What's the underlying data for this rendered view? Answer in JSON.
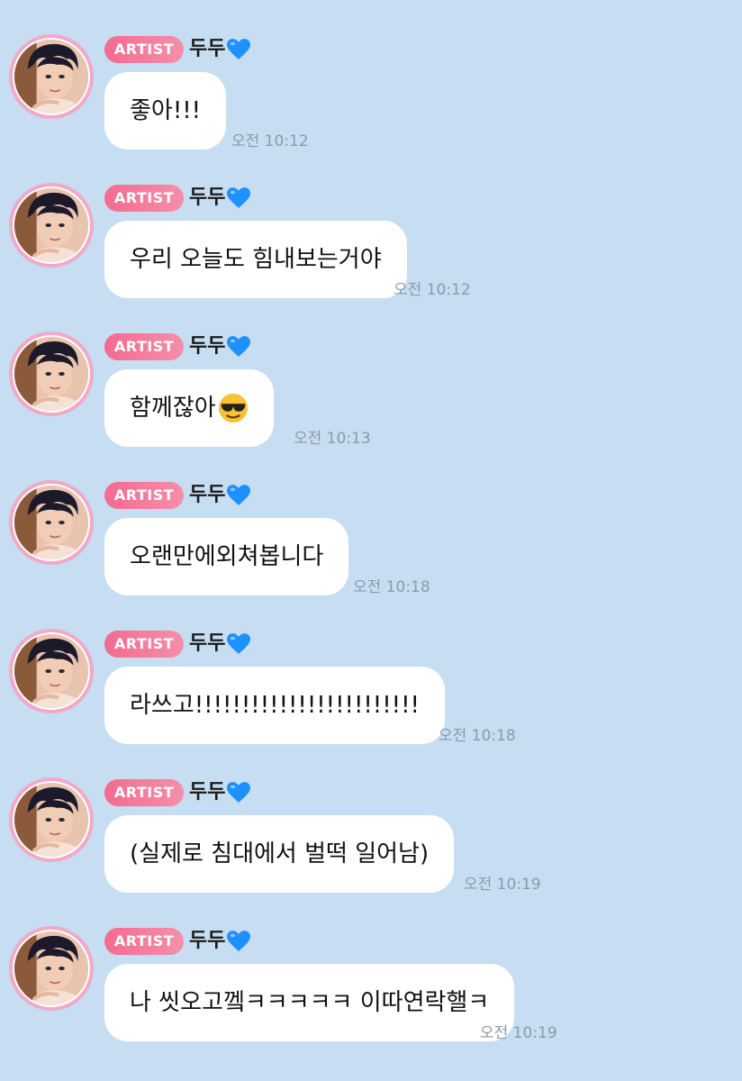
{
  "messages": [
    {
      "badge": "ARTIST",
      "sender": "두두",
      "text": "좋아!!!",
      "time": "오전 10:12",
      "emoji": ""
    },
    {
      "badge": "ARTIST",
      "sender": "두두",
      "text": "우리 오늘도 힘내보는거야",
      "time": "오전 10:12",
      "emoji": ""
    },
    {
      "badge": "ARTIST",
      "sender": "두두",
      "text": "함께잖아",
      "time": "오전 10:13",
      "emoji": "sunglasses-emoji"
    },
    {
      "badge": "ARTIST",
      "sender": "두두",
      "text": "오랜만에외쳐봅니다",
      "time": "오전 10:18",
      "emoji": ""
    },
    {
      "badge": "ARTIST",
      "sender": "두두",
      "text": "라쓰고!!!!!!!!!!!!!!!!!!!!!!!!",
      "time": "오전 10:18",
      "emoji": ""
    },
    {
      "badge": "ARTIST",
      "sender": "두두",
      "text": "(실제로 침대에서 벌떡 일어남)",
      "time": "오전 10:19",
      "emoji": ""
    },
    {
      "badge": "ARTIST",
      "sender": "두두",
      "text": "나 씻오고껰ㅋㅋㅋㅋㅋ 이따연락핼ㅋ",
      "time": "오전 10:19",
      "emoji": ""
    }
  ],
  "icons": {
    "sender_heart": "blue-heart-icon",
    "avatar": "artist-avatar"
  },
  "colors": {
    "background": "#c6ddf2",
    "bubble": "#ffffff",
    "badge_start": "#f36b90",
    "badge_end": "#f58fa9",
    "heart": "#1e90ff",
    "avatar_ring": "#f1a9c8",
    "time": "#8f9aa6"
  }
}
